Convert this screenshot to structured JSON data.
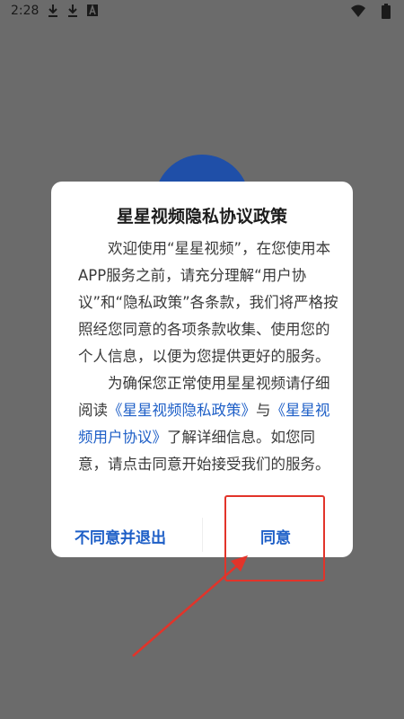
{
  "status_bar": {
    "time": "2:28",
    "left_icons": [
      "download-icon",
      "download-icon",
      "font-icon"
    ],
    "right_icons": [
      "wifi-icon",
      "battery-icon"
    ]
  },
  "dialog": {
    "title": "星星视频隐私协议政策",
    "paragraph1": "欢迎使用“星星视频”，在您使用本APP服务之前，请充分理解“用户协议”和“隐私政策”各条款，我们将严格按照经您同意的各项条款收集、使用您的个人信息，以便为您提供更好的服务。",
    "paragraph2_prefix": "为确保您正常使用星星视频请仔细阅读",
    "privacy_link": "《星星视频隐私政策》",
    "paragraph2_and": "与",
    "user_agreement_link": "《星星视频用户协议》",
    "paragraph2_suffix": "了解详细信息。如您同意，请点击同意开始接受我们的服务。",
    "disagree_label": "不同意并退出",
    "agree_label": "同意"
  },
  "colors": {
    "overlay": "#6b6b6b",
    "link": "#1e5fc7",
    "annotation": "#e2342a"
  }
}
